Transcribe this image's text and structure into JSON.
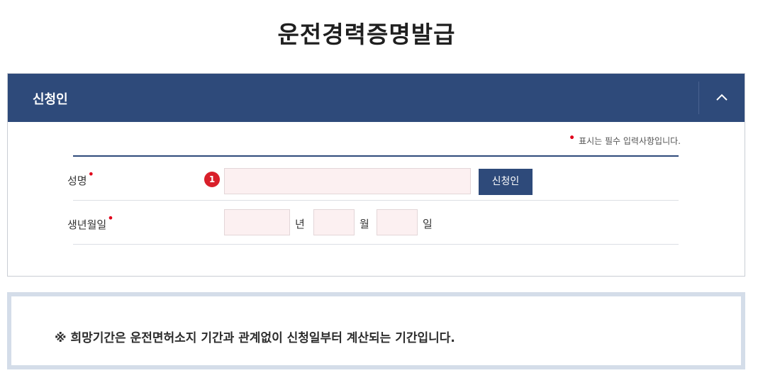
{
  "page": {
    "title": "운전경력증명발급"
  },
  "section": {
    "title": "신청인",
    "collapse_icon": "chevron-up-icon"
  },
  "required_note": {
    "marker": "•",
    "text": "표시는 필수 입력사항입니다."
  },
  "form": {
    "name": {
      "label": "성명",
      "required_marker": "•",
      "badge": "1",
      "value": "",
      "button_label": "신청인"
    },
    "birth": {
      "label": "생년월일",
      "required_marker": "•",
      "year_value": "",
      "year_unit": "년",
      "month_value": "",
      "month_unit": "월",
      "day_value": "",
      "day_unit": "일"
    }
  },
  "notice": {
    "text": "※ 희망기간은 운전면허소지 기간과 관계없이 신청일부터 계산되는 기간입니다."
  },
  "colors": {
    "header_bg": "#2e4a7a",
    "required": "#e0001b",
    "badge": "#d91f2a",
    "input_bg": "#fcf0f1"
  }
}
